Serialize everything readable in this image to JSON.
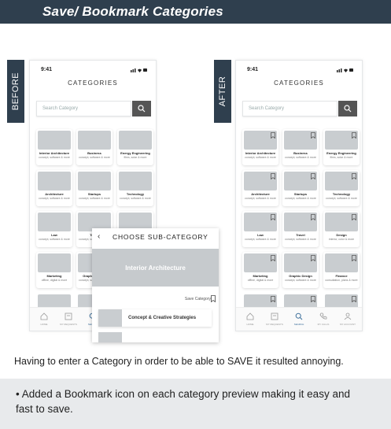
{
  "header": {
    "title": "Save/ Bookmark Categories"
  },
  "labels": {
    "before": "BEFORE",
    "after": "AFTER"
  },
  "phone": {
    "time": "9:41",
    "title": "CATEGORIES",
    "search_placeholder": "Search Category",
    "categories": [
      {
        "title": "Interior Architecture",
        "subtitle": "concept, software & more"
      },
      {
        "title": "Business",
        "subtitle": "concept, software & more"
      },
      {
        "title": "Energy Engineering",
        "subtitle": "films, solar & more"
      },
      {
        "title": "Architecture",
        "subtitle": "concept, software & more"
      },
      {
        "title": "Startups",
        "subtitle": "concept, software & more"
      },
      {
        "title": "Technology",
        "subtitle": "concept, software & more"
      },
      {
        "title": "Law",
        "subtitle": "concept, software & more"
      },
      {
        "title": "Travel",
        "subtitle": "concept, software & more"
      },
      {
        "title": "Design",
        "subtitle": "interior, color & more"
      },
      {
        "title": "Marketing",
        "subtitle": "offline, digital & more"
      },
      {
        "title": "Graphic Design",
        "subtitle": "concept, software & more"
      },
      {
        "title": "Finance",
        "subtitle": "consultation, plans & more"
      }
    ],
    "tabs": [
      "HOME",
      "MY REQUESTS",
      "SEARCH",
      "MY CALLS",
      "MY ACCOUNT"
    ]
  },
  "subcategory": {
    "title": "CHOOSE SUB-CATEGORY",
    "hero": "Interior Architecture",
    "save_label": "Save Category",
    "item": "Concept & Creative Strategies"
  },
  "caption": "Having to enter a Category in order to be able to SAVE it resulted annoying.",
  "note": "• Added a Bookmark icon on each category preview making it easy and fast to save.",
  "colors": {
    "header": "#2f3f4e",
    "thumb": "#c9cdd0",
    "accent": "#3b6e9a"
  }
}
